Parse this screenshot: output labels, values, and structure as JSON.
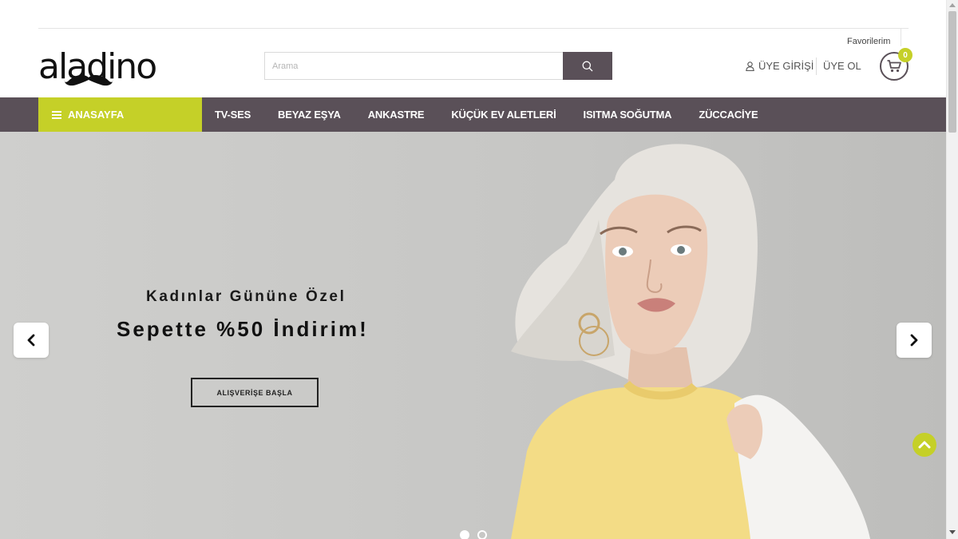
{
  "header": {
    "logo_text": "aladino",
    "search_placeholder": "Arama",
    "favorites_label": "Favorilerim",
    "login_label": "ÜYE GİRİŞİ",
    "register_label": "ÜYE OL",
    "cart_count": "0"
  },
  "nav": {
    "home_label": "ANASAYFA",
    "items": [
      "TV-SES",
      "BEYAZ EŞYA",
      "ANKASTRE",
      "KÜÇÜK EV ALETLERİ",
      "ISITMA SOĞUTMA",
      "ZÜCCACİYE"
    ]
  },
  "hero": {
    "subtitle": "Kadınlar Gününe Özel",
    "title": "Sepette %50 İndirim!",
    "cta_label": "ALIŞVERİŞE BAŞLA",
    "slide_count": 2,
    "active_slide": 1
  },
  "colors": {
    "accent": "#c5d028",
    "nav_bg": "#5a5058",
    "hero_bg": "#c7c7c5"
  },
  "icons": {
    "search": "search-icon",
    "user": "user-icon",
    "cart": "cart-icon",
    "menu": "hamburger-icon",
    "prev": "chevron-left-icon",
    "next": "chevron-right-icon",
    "scroll_top": "chevron-up-icon"
  }
}
